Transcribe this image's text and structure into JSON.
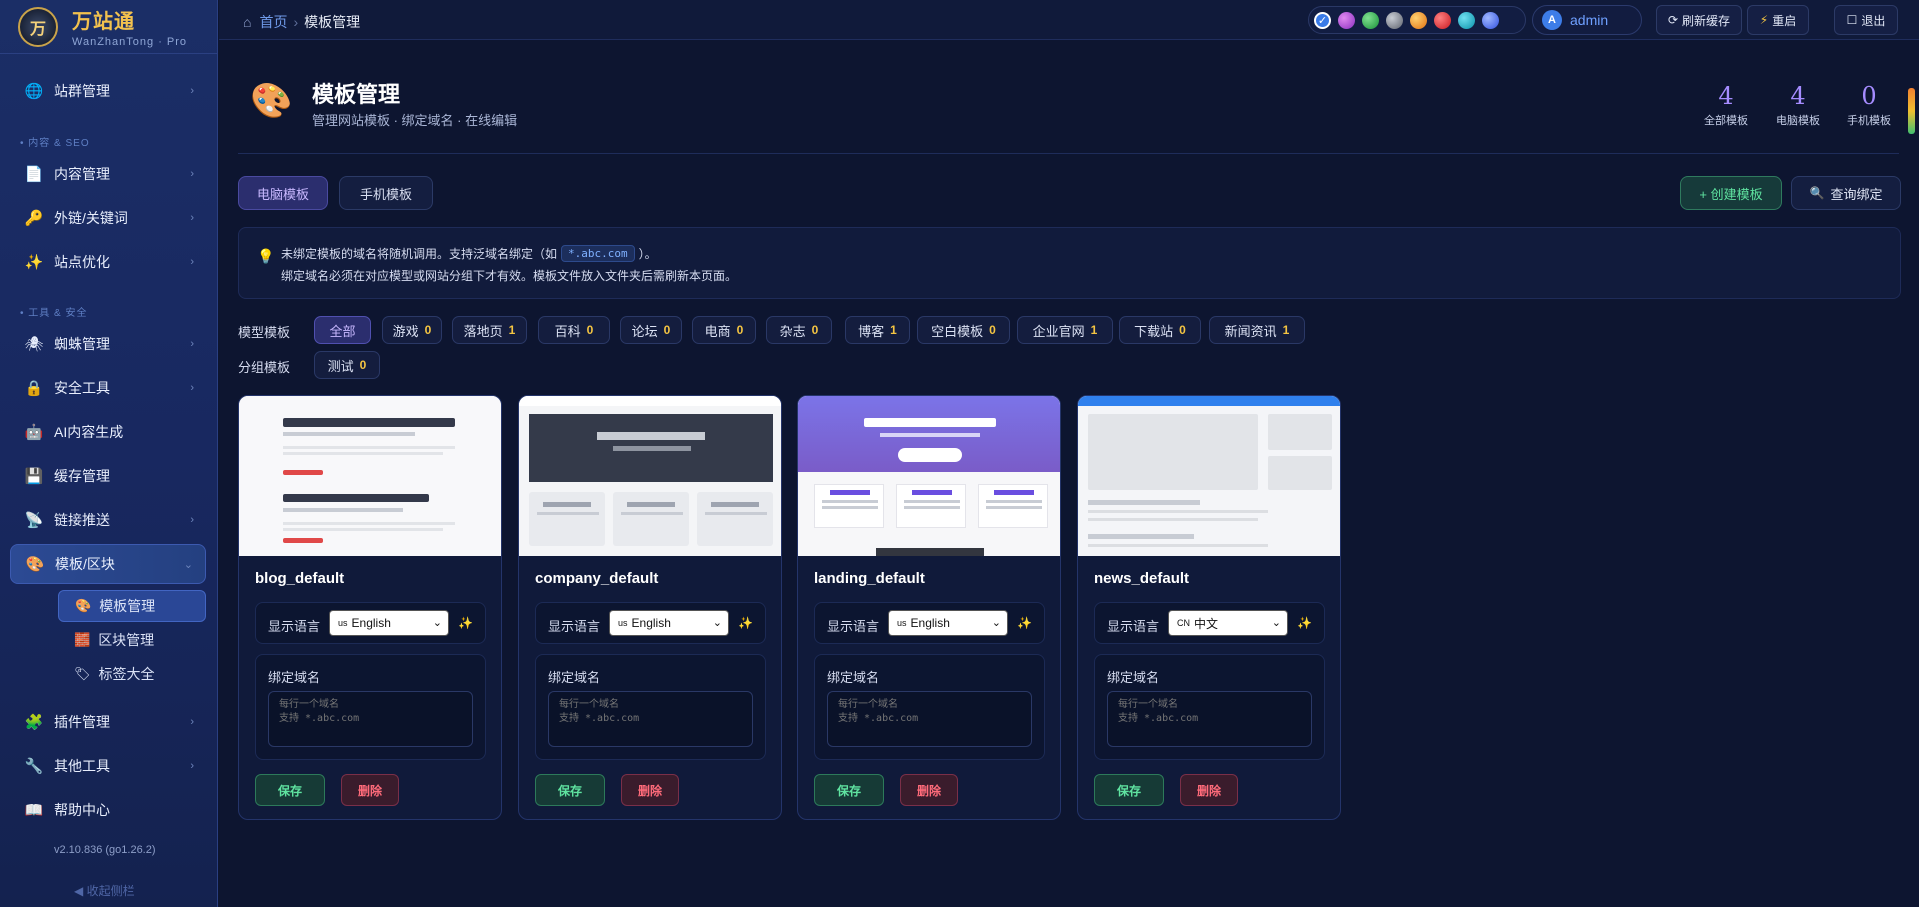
{
  "brand": {
    "name": "万站通",
    "sub": "WanZhanTong · Pro",
    "logo_char": "万"
  },
  "sidebar": {
    "items": [
      {
        "label": "站群管理",
        "icon": "globe-icon"
      },
      {
        "label": "内容管理",
        "icon": "document-icon"
      },
      {
        "label": "外链/关键词",
        "icon": "key-icon"
      },
      {
        "label": "站点优化",
        "icon": "sparkle-icon"
      },
      {
        "label": "蜘蛛管理",
        "icon": "spider-icon"
      },
      {
        "label": "安全工具",
        "icon": "lock-icon"
      },
      {
        "label": "AI内容生成",
        "icon": "robot-icon"
      },
      {
        "label": "缓存管理",
        "icon": "floppy-icon"
      },
      {
        "label": "链接推送",
        "icon": "satellite-icon"
      },
      {
        "label": "模板/区块",
        "icon": "palette-icon"
      },
      {
        "label": "插件管理",
        "icon": "puzzle-icon"
      },
      {
        "label": "其他工具",
        "icon": "wrench-icon"
      },
      {
        "label": "帮助中心",
        "icon": "book-icon"
      }
    ],
    "sections": {
      "content_seo": "• 内容 & SEO",
      "tools_security": "• 工具 & 安全"
    },
    "sub_items": [
      {
        "label": "模板管理",
        "icon": "palette-icon"
      },
      {
        "label": "区块管理",
        "icon": "brick-icon"
      },
      {
        "label": "标签大全",
        "icon": "tag-icon"
      }
    ],
    "version": "v2.10.836 (go1.26.2)",
    "collapse": "◀ 收起侧栏"
  },
  "topbar": {
    "breadcrumb_home": "首页",
    "breadcrumb_current": "模板管理",
    "swatches": [
      "#3a7be8",
      "#b04ee0",
      "#28b048",
      "#8a8f99",
      "#f09a1a",
      "#e8383a",
      "#1ab0c8",
      "#4a6cf0"
    ],
    "user_initial": "A",
    "user_name": "admin",
    "refresh_cache": "刷新缓存",
    "restart": "重启",
    "logout": "退出"
  },
  "header": {
    "title": "模板管理",
    "subtitle": "管理网站模板 · 绑定域名 · 在线编辑",
    "stats": [
      {
        "value": "4",
        "label": "全部模板"
      },
      {
        "value": "4",
        "label": "电脑模板"
      },
      {
        "value": "0",
        "label": "手机模板"
      }
    ]
  },
  "tabs": {
    "pc": "电脑模板",
    "mobile": "手机模板"
  },
  "actions": {
    "create": "+ 创建模板",
    "query": "查询绑定"
  },
  "notice": {
    "line1_pre": "未绑定模板的域名将随机调用。支持泛域名绑定（如",
    "line1_code": "*.abc.com",
    "line1_post": "）。",
    "line2": "绑定域名必须在对应模型或网站分组下才有效。模板文件放入文件夹后需刷新本页面。"
  },
  "filters": {
    "model_label": "模型模板",
    "group_label": "分组模板",
    "model_chips": [
      {
        "label": "全部",
        "count": ""
      },
      {
        "label": "游戏",
        "count": "0"
      },
      {
        "label": "落地页",
        "count": "1"
      },
      {
        "label": "百科",
        "count": "0"
      },
      {
        "label": "论坛",
        "count": "0"
      },
      {
        "label": "电商",
        "count": "0"
      },
      {
        "label": "杂志",
        "count": "0"
      },
      {
        "label": "博客",
        "count": "1"
      },
      {
        "label": "空白模板",
        "count": "0"
      },
      {
        "label": "企业官网",
        "count": "1"
      },
      {
        "label": "下载站",
        "count": "0"
      },
      {
        "label": "新闻资讯",
        "count": "1"
      }
    ],
    "group_chips": [
      {
        "label": "测试",
        "count": "0"
      }
    ]
  },
  "cards": [
    {
      "name": "blog_default",
      "lang_flag": "us",
      "lang": "English"
    },
    {
      "name": "company_default",
      "lang_flag": "us",
      "lang": "English"
    },
    {
      "name": "landing_default",
      "lang_flag": "us",
      "lang": "English"
    },
    {
      "name": "news_default",
      "lang_flag": "CN",
      "lang": "中文"
    }
  ],
  "card_labels": {
    "lang_label": "显示语言",
    "bind_label": "绑定域名",
    "bind_placeholder": "每行一个域名\n支持 *.abc.com",
    "save": "保存",
    "delete": "删除"
  }
}
